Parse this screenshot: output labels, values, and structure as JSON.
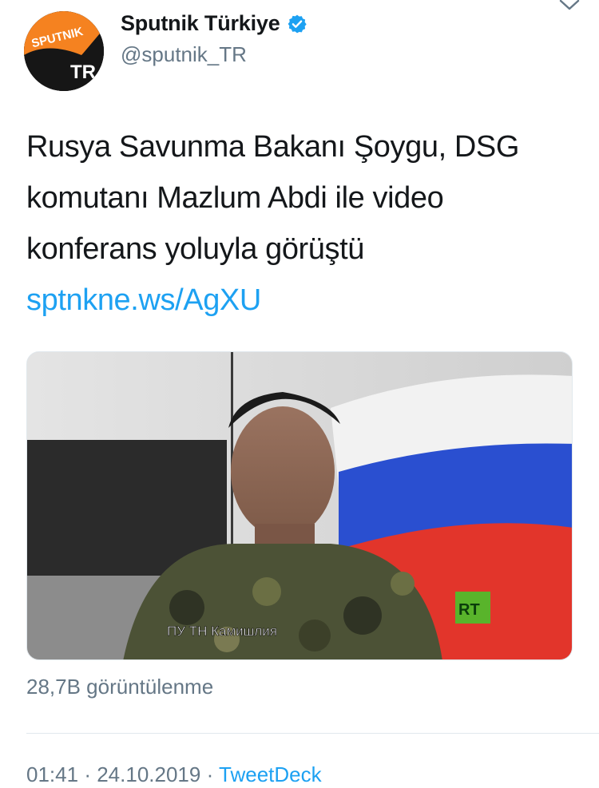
{
  "author": {
    "display_name": "Sputnik Türkiye",
    "handle": "@sputnik_TR",
    "avatar_text_top": "SPUTNIK",
    "avatar_text_bottom": "TR",
    "verified": true
  },
  "tweet": {
    "text": "Rusya Savunma Bakanı Şoygu, DSG komutanı Mazlum Abdi ile video konferans yoluyla görüştü ",
    "link": "sptnkne.ws/AgXU"
  },
  "media": {
    "caption": "ПУ ТН Камишлия",
    "channel_logo": "RT"
  },
  "stats": {
    "views": "28,7B görüntülenme"
  },
  "meta": {
    "time": "01:41",
    "separator": "·",
    "date": "24.10.2019",
    "source": "TweetDeck"
  },
  "icons": {
    "verified": "verified-badge-icon",
    "more": "chevron-down-icon"
  },
  "colors": {
    "link": "#1da1f2",
    "secondary_text": "#657786",
    "brand_orange": "#f58220"
  }
}
